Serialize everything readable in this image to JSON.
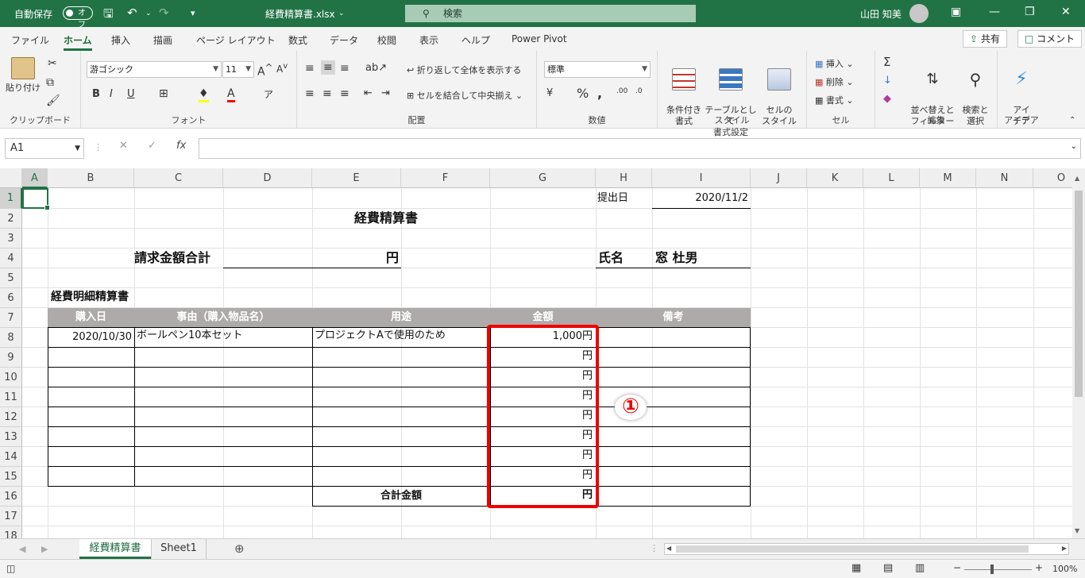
{
  "titlebar": {
    "autosave_label": "自動保存",
    "autosave_state": "オフ",
    "filename": "経費精算書.xlsx",
    "search_placeholder": "検索",
    "user_name": "山田 知美"
  },
  "tabs": [
    "ファイル",
    "ホーム",
    "挿入",
    "描画",
    "ページ レイアウト",
    "数式",
    "データ",
    "校閲",
    "表示",
    "ヘルプ",
    "Power Pivot"
  ],
  "share_label": "共有",
  "comment_label": "コメント",
  "ribbon": {
    "clipboard": {
      "paste_label": "貼り付け",
      "group_label": "クリップボード"
    },
    "font": {
      "font_name": "游ゴシック",
      "font_size": "11",
      "group_label": "フォント"
    },
    "alignment": {
      "wrap_label": "折り返して全体を表示する",
      "merge_label": "セルを結合して中央揃え",
      "group_label": "配置"
    },
    "number": {
      "format": "標準",
      "group_label": "数値"
    },
    "styles": {
      "cond_label": "条件付き\n書式",
      "table_label": "テーブルとして\n書式設定",
      "cell_label": "セルの\nスタイル",
      "group_label": "スタイル"
    },
    "cells": {
      "insert_label": "挿入",
      "delete_label": "削除",
      "format_label": "書式",
      "group_label": "セル"
    },
    "editing": {
      "sort_label": "並べ替えと\nフィルター",
      "find_label": "検索と\n選択",
      "group_label": "編集"
    },
    "ideas": {
      "ideas_label": "アイ\nデア",
      "group_label": "アイデア"
    }
  },
  "formula_bar": {
    "name_box": "A1",
    "fx_label": "fx",
    "formula": ""
  },
  "columns": [
    "A",
    "B",
    "C",
    "D",
    "E",
    "F",
    "G",
    "H",
    "I",
    "J",
    "K",
    "L",
    "M",
    "N",
    "O"
  ],
  "rows": [
    "1",
    "2",
    "3",
    "4",
    "5",
    "6",
    "7",
    "8",
    "9",
    "10",
    "11",
    "12",
    "13",
    "14",
    "15",
    "16",
    "17",
    "18"
  ],
  "sheet": {
    "submit_label": "提出日",
    "submit_date": "2020/11/2",
    "title": "経費精算書",
    "total_label": "請求金額合計",
    "yen": "円",
    "name_label": "氏名",
    "name_value": "窓 杜男",
    "detail_title": "経費明細精算書",
    "headers": [
      "購入日",
      "事由（購入物品名）",
      "用途",
      "金額",
      "備考"
    ],
    "row8": {
      "date": "2020/10/30",
      "item": "ボールペン10本セット",
      "purpose": "プロジェクトAで使用のため",
      "amount": "1,000円"
    },
    "yen_rows": [
      "円",
      "円",
      "円",
      "円",
      "円",
      "円",
      "円"
    ],
    "sum_label": "合計金額",
    "sum_value": "円"
  },
  "callout": "①",
  "sheet_tabs": [
    "経費精算書",
    "Sheet1"
  ],
  "status": {
    "zoom": "100%"
  },
  "colors": {
    "excel_green": "#217346",
    "header_fill": "#AEAAAA",
    "highlight": "#EE0000"
  }
}
